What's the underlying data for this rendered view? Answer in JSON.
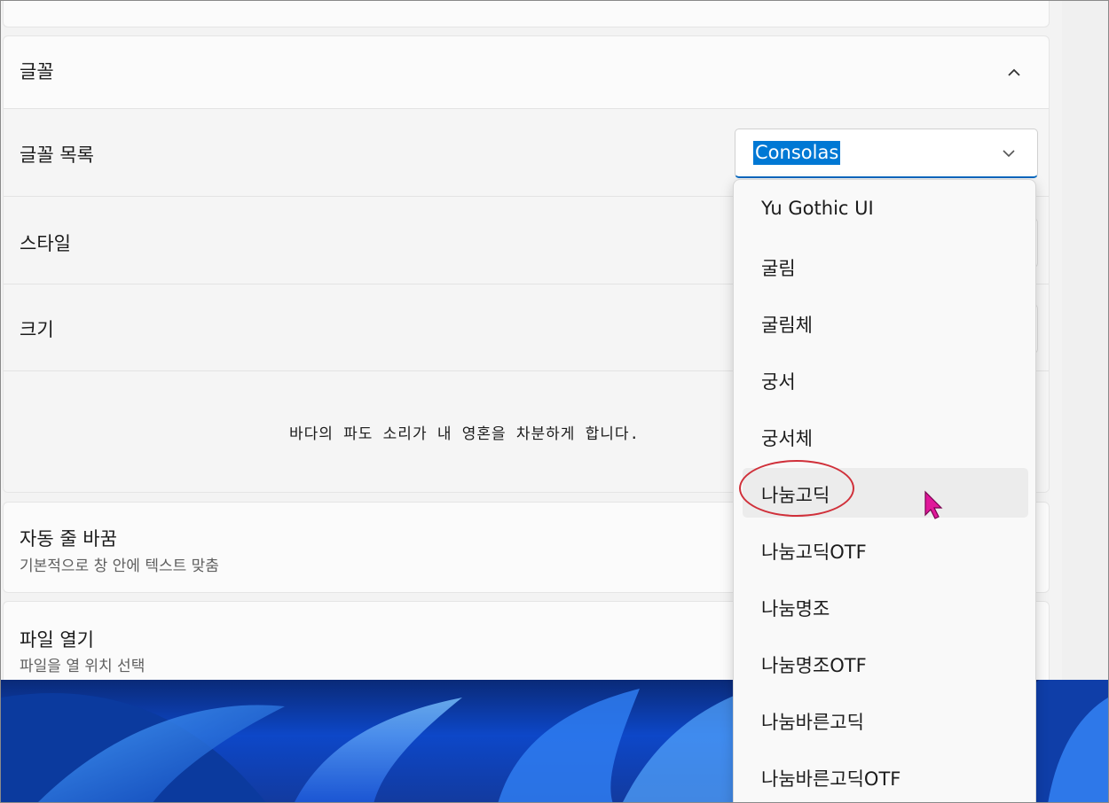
{
  "font_section": {
    "title": "글꼴",
    "font_list": {
      "label": "글꼴 목록",
      "selected": "Consolas"
    },
    "style": {
      "label": "스타일"
    },
    "size": {
      "label": "크기"
    },
    "preview_text": "바다의 파도 소리가 내 영혼을 차분하게 합니다."
  },
  "word_wrap": {
    "title": "자동 줄 바꿈",
    "description": "기본적으로 창 안에 텍스트 맞춤"
  },
  "open_file": {
    "title": "파일 열기",
    "description": "파일을 열 위치 선택"
  },
  "dropdown": {
    "options": [
      "Yu Gothic UI",
      "굴림",
      "굴림체",
      "궁서",
      "궁서체",
      "나눔고딕",
      "나눔고딕OTF",
      "나눔명조",
      "나눔명조OTF",
      "나눔바른고딕",
      "나눔바른고딕OTF"
    ],
    "hovered_option": "나눔고딕"
  },
  "colors": {
    "accent": "#0067c0",
    "selection": "#0078d4",
    "annotation": "#d0303a",
    "cursor": "#e0189a"
  },
  "icons": {
    "collapse": "chevron-up-icon",
    "dropdown": "chevron-down-icon",
    "pointer": "mouse-pointer-icon"
  }
}
